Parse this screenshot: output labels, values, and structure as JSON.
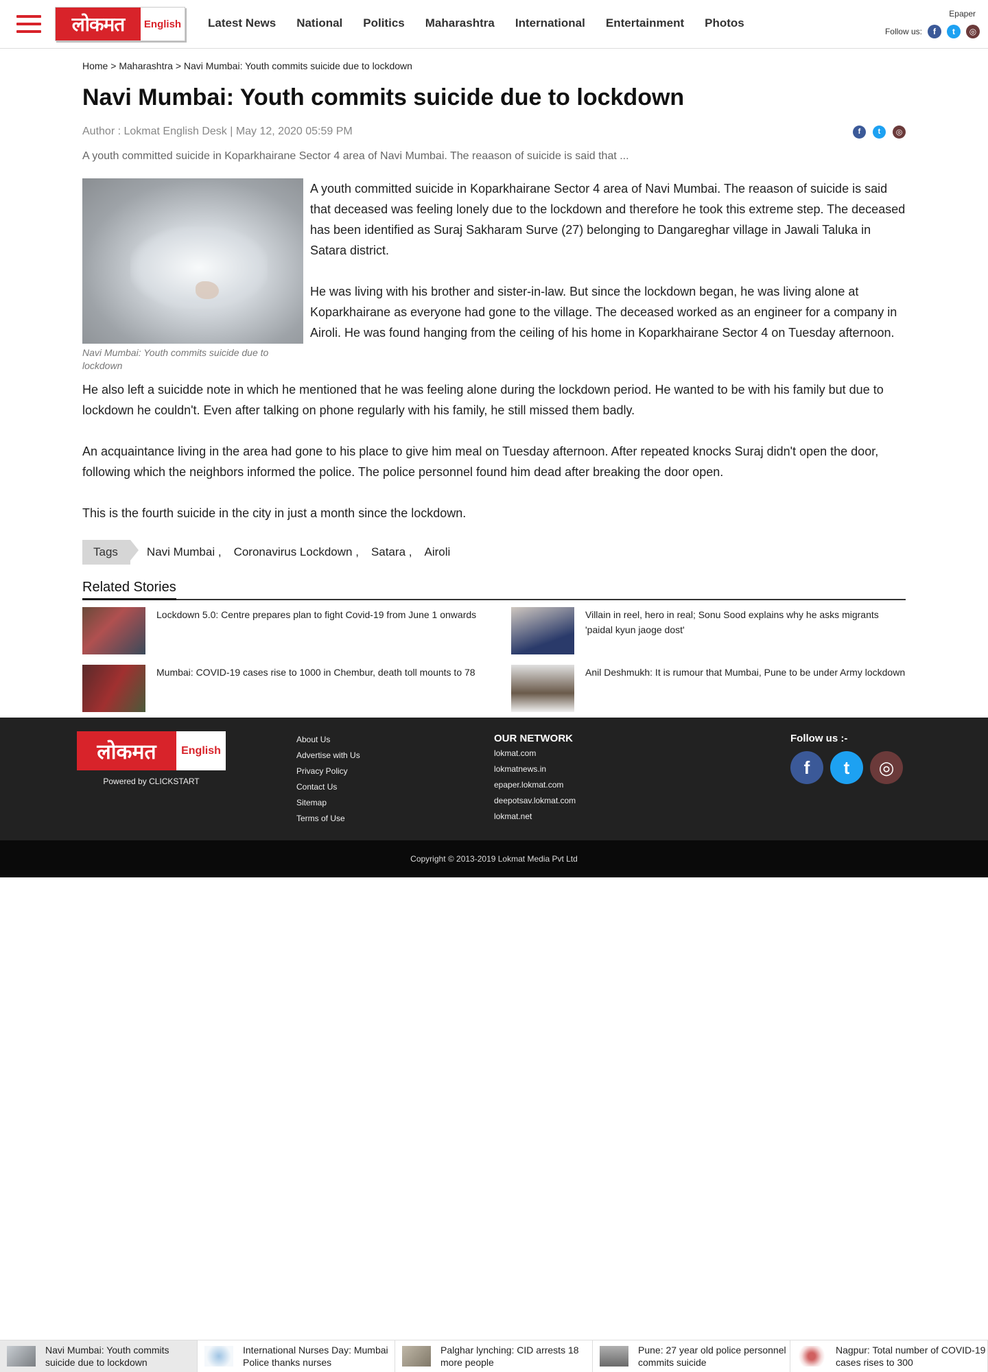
{
  "header": {
    "logo_text": "लोकमत",
    "logo_sub": "English",
    "nav": [
      "Latest News",
      "National",
      "Politics",
      "Maharashtra",
      "International",
      "Entertainment",
      "Photos"
    ],
    "epaper": "Epaper",
    "follow_label": "Follow us:"
  },
  "article": {
    "breadcrumb": [
      "Home",
      "Maharashtra",
      "Navi Mumbai: Youth commits suicide due to lockdown"
    ],
    "breadcrumb_sep": ">",
    "title": "Navi Mumbai: Youth commits suicide due to lockdown",
    "meta": "Author : Lokmat English Desk | May 12, 2020 05:59 PM",
    "lede": "A youth committed suicide in Koparkhairane Sector 4 area of Navi Mumbai. The reaason of suicide is said that ...",
    "image_caption": "Navi Mumbai: Youth commits suicide due to lockdown",
    "paragraphs": [
      "A youth committed suicide in Koparkhairane Sector 4 area of Navi Mumbai. The reaason of suicide is said that deceased was feeling lonely due to the lockdown and therefore he took this extreme step. The deceased has been identified as Suraj Sakharam Surve (27) belonging to Dangareghar village in Jawali Taluka in Satara district.",
      "He was living with his brother and sister-in-law. But since the lockdown began, he was living alone at Koparkhairane as everyone had gone to the village. The deceased worked as an engineer for a company in Airoli. He was found hanging from the ceiling of his home in Koparkhairane Sector 4 on Tuesday afternoon.",
      "He also left a suicidde note in which he mentioned that he was feeling alone during the lockdown period. He wanted to be with his family but due to lockdown he couldn't. Even after talking on phone regularly with his family, he still missed them badly.",
      "An acquaintance living in the area had gone to his place to give him meal on Tuesday afternoon. After repeated knocks Suraj didn't open the door, following which the neighbors informed the police. The police personnel found him dead after breaking the door open.",
      "This is the fourth suicide in the city in just a month since the lockdown."
    ],
    "tags_label": "Tags",
    "tags": [
      "Navi Mumbai ,",
      "Coronavirus Lockdown ,",
      "Satara ,",
      "Airoli"
    ]
  },
  "related": {
    "heading": "Related Stories",
    "stories": [
      {
        "title": "Lockdown 5.0: Centre prepares plan to fight Covid-19 from June 1 onwards",
        "color": "#7a5a4a"
      },
      {
        "title": "Villain in reel, hero in real; Sonu Sood explains why he asks migrants 'paidal kyun jaoge dost'",
        "color": "#4a6a8a"
      },
      {
        "title": "Mumbai: COVID-19 cases rise to 1000 in Chembur, death toll mounts to 78",
        "color": "#8a3a3a"
      },
      {
        "title": "Anil Deshmukh: It is rumour that Mumbai, Pune to be under Army lockdown",
        "color": "#7a7a7a"
      }
    ]
  },
  "footer": {
    "logo_text": "लोकमत",
    "logo_sub": "English",
    "powered": "Powered by CLICKSTART",
    "links": [
      "About Us",
      "Advertise with Us",
      "Privacy Policy",
      "Contact Us",
      "Sitemap",
      "Terms of Use"
    ],
    "network_heading": "OUR NETWORK",
    "network": [
      "lokmat.com",
      "lokmatnews.in",
      "epaper.lokmat.com",
      "deepotsav.lokmat.com",
      "lokmat.net"
    ],
    "follow_heading": "Follow us :-",
    "copyright": "Copyright © 2013-2019 Lokmat Media Pvt Ltd"
  },
  "strip": [
    {
      "title": "Navi Mumbai: Youth commits suicide due to lockdown",
      "color": "#8a8e92"
    },
    {
      "title": "International Nurses Day: Mumbai Police thanks nurses",
      "color": "#b8d4e8"
    },
    {
      "title": "Palghar lynching: CID arrests 18 more people",
      "color": "#a8a090"
    },
    {
      "title": "Pune: 27 year old police personnel commits suicide",
      "color": "#909090"
    },
    {
      "title": "Nagpur: Total number of COVID-19 cases rises to 300",
      "color": "#c89090"
    }
  ]
}
